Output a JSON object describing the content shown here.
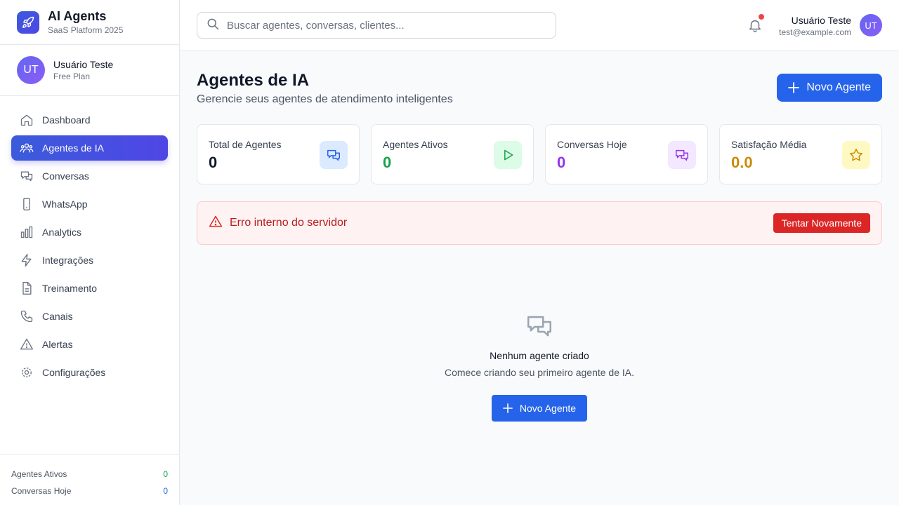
{
  "brand": {
    "title": "AI Agents",
    "subtitle": "SaaS Platform 2025",
    "icon": "rocket-icon"
  },
  "sidebar_user": {
    "initials": "UT",
    "name": "Usuário Teste",
    "plan": "Free Plan"
  },
  "nav": {
    "items": [
      {
        "label": "Dashboard",
        "icon": "home-icon",
        "active": false
      },
      {
        "label": "Agentes de IA",
        "icon": "users-icon",
        "active": true
      },
      {
        "label": "Conversas",
        "icon": "chat-icon",
        "active": false
      },
      {
        "label": "WhatsApp",
        "icon": "phone-device-icon",
        "active": false
      },
      {
        "label": "Analytics",
        "icon": "bar-chart-icon",
        "active": false
      },
      {
        "label": "Integrações",
        "icon": "lightning-icon",
        "active": false
      },
      {
        "label": "Treinamento",
        "icon": "document-icon",
        "active": false
      },
      {
        "label": "Canais",
        "icon": "phone-icon",
        "active": false
      },
      {
        "label": "Alertas",
        "icon": "warning-icon",
        "active": false
      },
      {
        "label": "Configurações",
        "icon": "gear-icon",
        "active": false
      }
    ]
  },
  "sidebar_footer": {
    "agents_label": "Agentes Ativos",
    "agents_value": "0",
    "convs_label": "Conversas Hoje",
    "convs_value": "0"
  },
  "header": {
    "search_placeholder": "Buscar agentes, conversas, clientes...",
    "user_name": "Usuário Teste",
    "user_email": "test@example.com",
    "user_initials": "UT",
    "has_notification": true
  },
  "page": {
    "title": "Agentes de IA",
    "subtitle": "Gerencie seus agentes de atendimento inteligentes",
    "new_button": "Novo Agente"
  },
  "stats": [
    {
      "label": "Total de Agentes",
      "value": "0",
      "color": "#111827",
      "icon": "chat-icon",
      "icon_bg": "#dbeafe",
      "icon_color": "#2563eb"
    },
    {
      "label": "Agentes Ativos",
      "value": "0",
      "color": "#16a34a",
      "icon": "play-icon",
      "icon_bg": "#dcfce7",
      "icon_color": "#16a34a"
    },
    {
      "label": "Conversas Hoje",
      "value": "0",
      "color": "#9333ea",
      "icon": "chat-icon",
      "icon_bg": "#f3e8ff",
      "icon_color": "#9333ea"
    },
    {
      "label": "Satisfação Média",
      "value": "0.0",
      "color": "#ca8a04",
      "icon": "star-icon",
      "icon_bg": "#fef9c3",
      "icon_color": "#ca8a04"
    }
  ],
  "error": {
    "message": "Erro interno do servidor",
    "retry_label": "Tentar Novamente"
  },
  "empty_state": {
    "title": "Nenhum agente criado",
    "subtitle": "Comece criando seu primeiro agente de IA.",
    "button": "Novo Agente"
  },
  "colors": {
    "primary": "#2563eb",
    "accent_gradient_start": "#3b5bdb",
    "accent_gradient_end": "#4f46e5",
    "danger": "#dc2626"
  }
}
